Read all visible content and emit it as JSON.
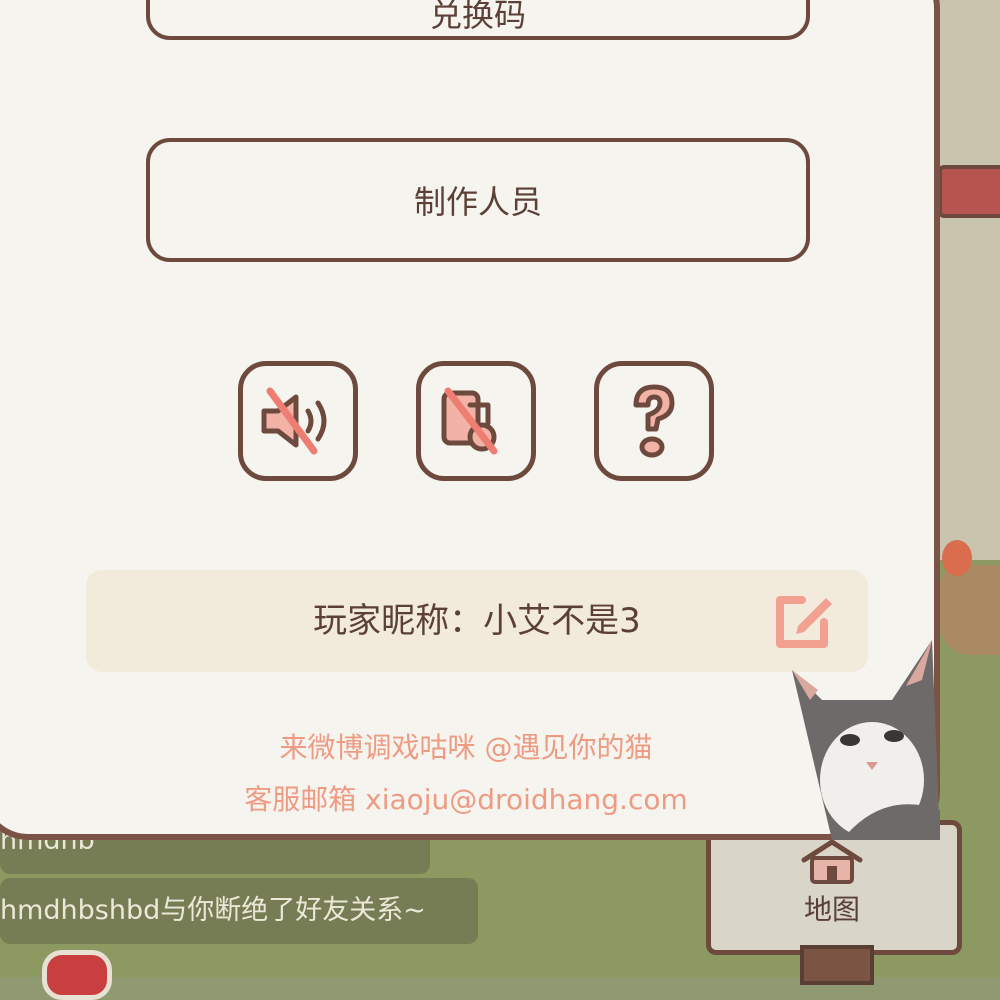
{
  "background": {
    "chat_line_1": "hmdhb",
    "chat_line_2": "hmdhbshbd与你断绝了好友关系~",
    "map_button_label": "地图"
  },
  "settings": {
    "redeem_code_button": "兑换码",
    "credits_button": "制作人员",
    "icons": {
      "sound": "sound-muted-icon",
      "music": "music-muted-icon",
      "help": "help-question-icon"
    },
    "nickname": "玩家昵称：小艾不是3",
    "edit_icon": "edit-icon",
    "weibo_line": "来微博调戏咕咪 @遇见你的猫",
    "email_line": "客服邮箱 xiaoju@droidhang.com"
  },
  "colors": {
    "panel_bg": "#f6f4ee",
    "border_brown": "#6e4a3e",
    "accent_pink": "#ee9b84",
    "icon_fill": "#f2b3a6",
    "nickname_bar": "#f2ebdc"
  }
}
